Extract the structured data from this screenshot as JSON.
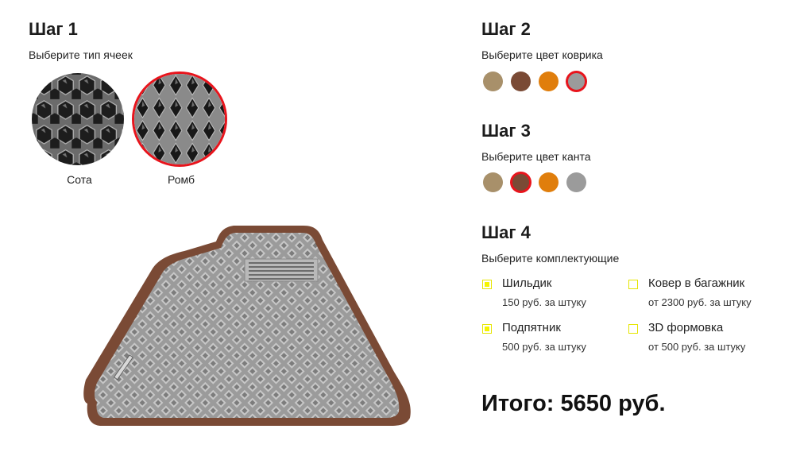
{
  "step1": {
    "title": "Шаг 1",
    "subtitle": "Выберите тип ячеек",
    "options": [
      {
        "label": "Сота",
        "selected": false
      },
      {
        "label": "Ромб",
        "selected": true
      }
    ]
  },
  "step2": {
    "title": "Шаг 2",
    "subtitle": "Выберите цвет коврика",
    "colors": [
      "#a8906a",
      "#7a4a35",
      "#e07e0c",
      "#9b9b9b"
    ],
    "selected_index": 3
  },
  "step3": {
    "title": "Шаг 3",
    "subtitle": "Выберите цвет канта",
    "colors": [
      "#a8906a",
      "#7a4a35",
      "#e07e0c",
      "#9b9b9b"
    ],
    "selected_index": 1
  },
  "step4": {
    "title": "Шаг 4",
    "subtitle": "Выберите комплектующие",
    "options": [
      {
        "name": "Шильдик",
        "price": "150 руб. за штуку",
        "checked": true
      },
      {
        "name": "Ковер в багажник",
        "price": "от 2300 руб. за штуку",
        "checked": false
      },
      {
        "name": "Подпятник",
        "price": "500 руб. за штуку",
        "checked": true
      },
      {
        "name": "3D формовка",
        "price": "от 500 руб. за штуку",
        "checked": false
      }
    ]
  },
  "total": "Итого: 5650 руб.",
  "preview": {
    "mat_color": "#9b9b9b",
    "edge_color": "#7a4a35"
  }
}
